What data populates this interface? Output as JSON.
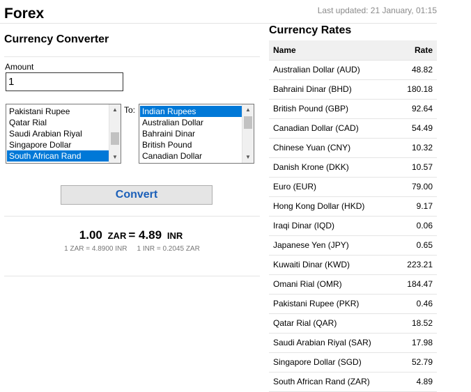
{
  "header": {
    "title": "Forex",
    "last_updated": "Last updated: 21 January, 01:15"
  },
  "converter": {
    "title": "Currency Converter",
    "amount_label": "Amount",
    "amount_value": "1",
    "to_label": "To:",
    "from_list": {
      "items": [
        "Pakistani Rupee",
        "Qatar Rial",
        "Saudi Arabian Riyal",
        "Singapore Dollar",
        "South African Rand"
      ],
      "selected": "South African Rand"
    },
    "to_list": {
      "items": [
        "Indian Rupees",
        "Australian Dollar",
        "Bahraini Dinar",
        "British Pound",
        "Canadian Dollar"
      ],
      "selected": "Indian Rupees"
    },
    "convert_label": "Convert",
    "result": {
      "from_amount": "1.00",
      "from_code": "ZAR",
      "equals": "=",
      "to_amount": "4.89",
      "to_code": "INR",
      "rate_forward": "1 ZAR = 4.8900 INR",
      "rate_reverse": "1 INR = 0.2045 ZAR"
    }
  },
  "rates": {
    "title": "Currency Rates",
    "columns": [
      "Name",
      "Rate"
    ],
    "rows": [
      [
        "Australian Dollar (AUD)",
        "48.82"
      ],
      [
        "Bahraini Dinar (BHD)",
        "180.18"
      ],
      [
        "British Pound (GBP)",
        "92.64"
      ],
      [
        "Canadian Dollar (CAD)",
        "54.49"
      ],
      [
        "Chinese Yuan (CNY)",
        "10.32"
      ],
      [
        "Danish Krone (DKK)",
        "10.57"
      ],
      [
        "Euro (EUR)",
        "79.00"
      ],
      [
        "Hong Kong Dollar (HKD)",
        "9.17"
      ],
      [
        "Iraqi Dinar (IQD)",
        "0.06"
      ],
      [
        "Japanese Yen (JPY)",
        "0.65"
      ],
      [
        "Kuwaiti Dinar (KWD)",
        "223.21"
      ],
      [
        "Omani Rial (OMR)",
        "184.47"
      ],
      [
        "Pakistani Rupee (PKR)",
        "0.46"
      ],
      [
        "Qatar Rial (QAR)",
        "18.52"
      ],
      [
        "Saudi Arabian Riyal (SAR)",
        "17.98"
      ],
      [
        "Singapore Dollar (SGD)",
        "52.79"
      ],
      [
        "South African Rand (ZAR)",
        "4.89"
      ]
    ]
  },
  "colors": {
    "selection": "#0078d7",
    "convert_text": "#1b5fb8",
    "muted_text": "#8a8a8a"
  }
}
